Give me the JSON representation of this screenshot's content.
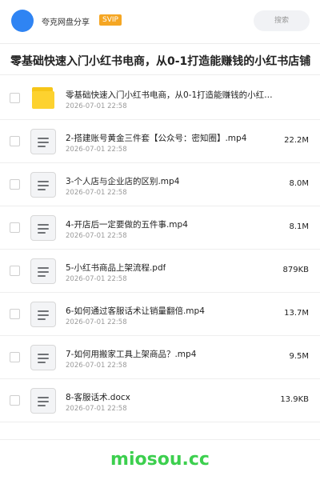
{
  "header": {
    "brand": "夸克网盘分享",
    "badge": "SVIP",
    "search_placeholder": "搜索"
  },
  "title": "零基础快速入门小红书电商，从0-1打造能赚钱的小红书店铺",
  "files": [
    {
      "icon": "folder-icon",
      "name": "零基础快速入门小红书电商，从0-1打造能赚钱的小红…",
      "date": "2026-07-01 22:58",
      "size": ""
    },
    {
      "icon": "file-icon",
      "name": "2-搭建账号黄金三件套【公众号：密知圈】.mp4",
      "date": "2026-07-01 22:58",
      "size": "22.2M"
    },
    {
      "icon": "file-icon",
      "name": "3-个人店与企业店的区别.mp4",
      "date": "2026-07-01 22:58",
      "size": "8.0M"
    },
    {
      "icon": "file-icon",
      "name": "4-开店后一定要做的五件事.mp4",
      "date": "2026-07-01 22:58",
      "size": "8.1M"
    },
    {
      "icon": "file-icon",
      "name": "5-小红书商品上架流程.pdf",
      "date": "2026-07-01 22:58",
      "size": "879KB"
    },
    {
      "icon": "file-icon",
      "name": "6-如何通过客服话术让销量翻倍.mp4",
      "date": "2026-07-01 22:58",
      "size": "13.7M"
    },
    {
      "icon": "file-icon",
      "name": "7-如何用搬家工具上架商品？.mp4",
      "date": "2026-07-01 22:58",
      "size": "9.5M"
    },
    {
      "icon": "file-icon",
      "name": "8-客服话术.docx",
      "date": "2026-07-01 22:58",
      "size": "13.9KB"
    }
  ],
  "footer": {
    "site": "miosou.cc"
  },
  "colors": {
    "accent": "#2f84f3",
    "badge": "#f5a623",
    "folder": "#fdd22f",
    "watermark": "#3ccf4e"
  }
}
